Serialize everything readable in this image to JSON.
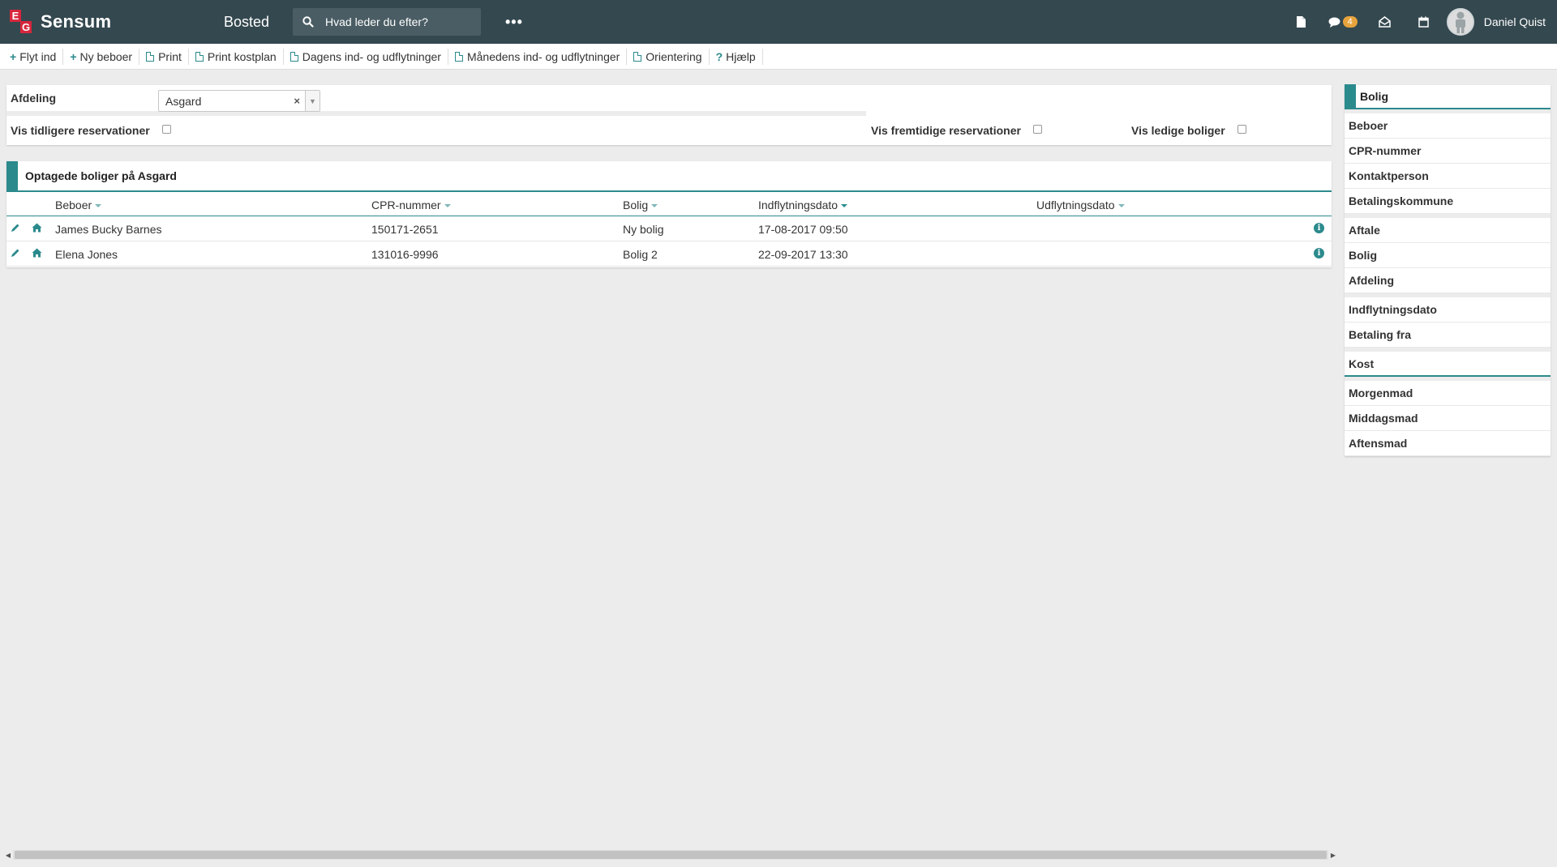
{
  "app": {
    "logo_e": "E",
    "logo_g": "G",
    "name": "Sensum",
    "module": "Bosted",
    "search_placeholder": "Hvad leder du efter?",
    "more_label": "•••",
    "chat_count": "4",
    "user_name": "Daniel Quist"
  },
  "toolbar": {
    "items": [
      {
        "label": "Flyt ind",
        "icon": "plus-icon"
      },
      {
        "label": "Ny beboer",
        "icon": "plus-icon"
      },
      {
        "label": "Print",
        "icon": "pdf-icon"
      },
      {
        "label": "Print kostplan",
        "icon": "pdf-icon"
      },
      {
        "label": "Dagens ind- og udflytninger",
        "icon": "pdf-icon"
      },
      {
        "label": "Månedens ind- og udflytninger",
        "icon": "pdf-icon"
      },
      {
        "label": "Orientering",
        "icon": "pdf-icon"
      },
      {
        "label": "Hjælp",
        "icon": "question-icon"
      }
    ]
  },
  "filter": {
    "afdeling_label": "Afdeling",
    "afdeling_value": "Asgard",
    "vis_tidligere": "Vis tidligere reservationer",
    "vis_fremtidige": "Vis fremtidige reservationer",
    "vis_ledige": "Vis ledige boliger"
  },
  "table": {
    "title": "Optagede boliger på Asgard",
    "columns": [
      "Beboer",
      "CPR-nummer",
      "Bolig",
      "Indflytningsdato",
      "Udflytningsdato"
    ],
    "rows": [
      {
        "beboer": "James Bucky Barnes",
        "cpr": "150171-2651",
        "bolig": "Ny bolig",
        "ind": "17-08-2017 09:50",
        "ud": ""
      },
      {
        "beboer": "Elena Jones",
        "cpr": "131016-9996",
        "bolig": "Bolig 2",
        "ind": "22-09-2017 13:30",
        "ud": ""
      }
    ]
  },
  "sidebar": {
    "title": "Bolig",
    "group1": [
      "Beboer",
      "CPR-nummer",
      "Kontaktperson",
      "Betalingskommune"
    ],
    "group2": [
      "Aftale",
      "Bolig",
      "Afdeling"
    ],
    "group3": [
      "Indflytningsdato",
      "Betaling fra"
    ],
    "kost": "Kost",
    "group4": [
      "Morgenmad",
      "Middagsmad",
      "Aftensmad"
    ]
  },
  "colors": {
    "topbar": "#34484f",
    "accent": "#2b8a8c",
    "badge": "#e8a33d",
    "logo_red": "#d7263d"
  }
}
